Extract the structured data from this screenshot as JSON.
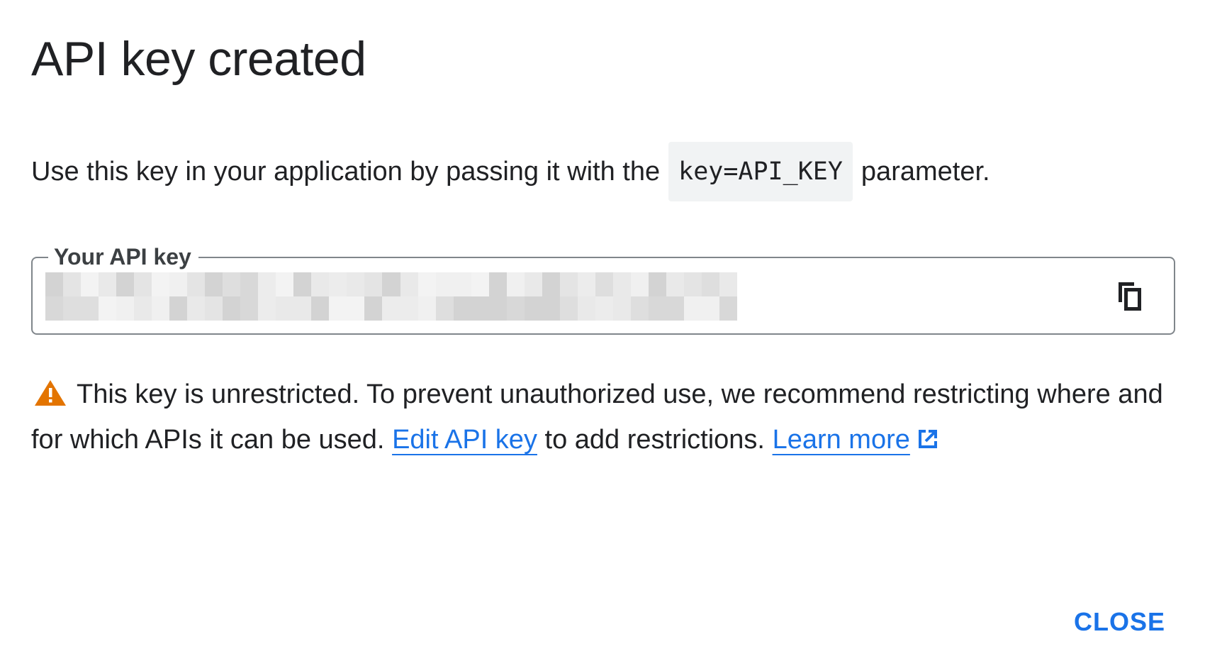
{
  "dialog": {
    "title": "API key created",
    "instructions_prefix": "Use this key in your application by passing it with the",
    "instructions_code": "key=API_KEY",
    "instructions_suffix": "parameter.",
    "key_field": {
      "label": "Your API key",
      "value_state": "redacted",
      "copy_icon": "copy-icon"
    },
    "warning": {
      "icon": "warning-icon",
      "text_part1": "This key is unrestricted. To prevent unauthorized use, we recommend restricting where and for which APIs it can be used.",
      "edit_link": "Edit API key",
      "text_part2": "to add restrictions.",
      "learn_more_link": "Learn more",
      "external_icon": "open-in-new-icon"
    },
    "close_label": "CLOSE"
  },
  "colors": {
    "link": "#1a73e8",
    "warning": "#e37400",
    "border": "#80868b",
    "code_bg": "#f1f3f4",
    "text": "#202124"
  }
}
